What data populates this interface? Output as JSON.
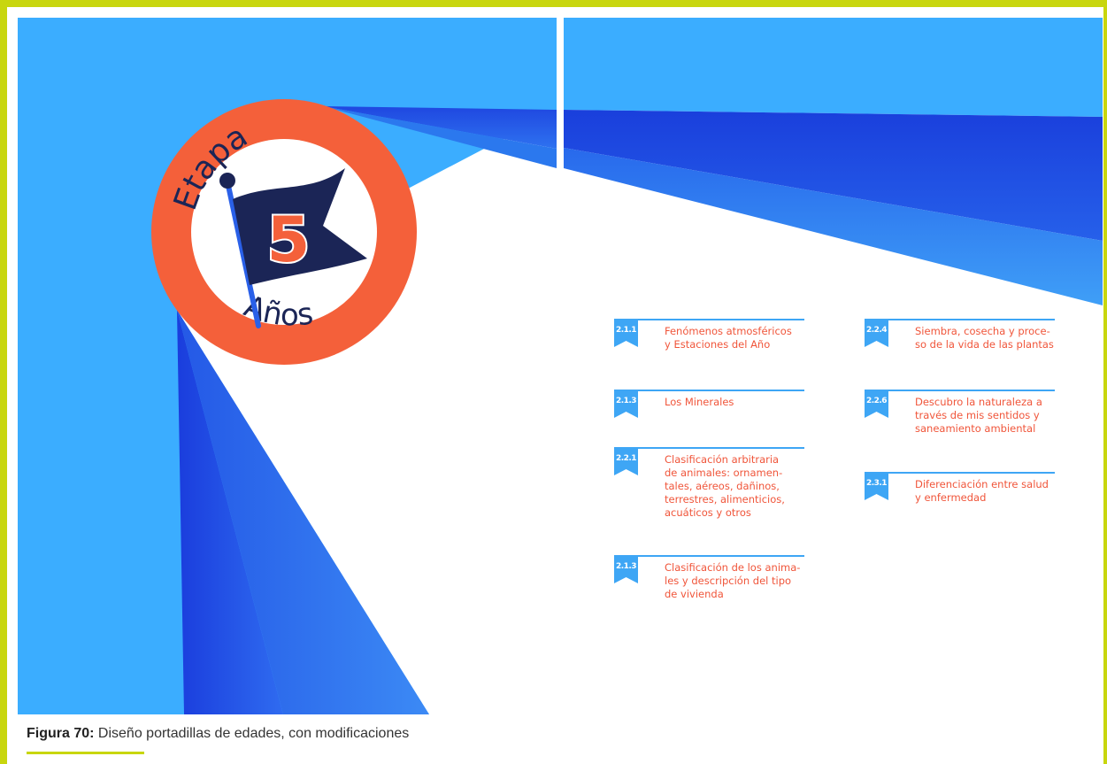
{
  "badge": {
    "top_word": "Etapa",
    "number": "5",
    "bottom_word": "Años"
  },
  "topics": [
    {
      "code": "2.1.1",
      "text": "Fenómenos atmosféricos\ny Estaciones del Año"
    },
    {
      "code": "2.1.3",
      "text": "Los Minerales"
    },
    {
      "code": "2.2.1",
      "text": "Clasificación arbitraria\nde animales: ornamen-\ntales, aéreos, dañinos,\nterrestres, alimenticios,\nacuáticos y otros"
    },
    {
      "code": "2.1.3",
      "text": "Clasificación de los anima-\nles y descripción del tipo\nde vivienda"
    },
    {
      "code": "2.2.4",
      "text": "Siembra, cosecha y proce-\nso de la vida de las plantas"
    },
    {
      "code": "2.2.6",
      "text": "Descubro la naturaleza  a\ntravés de mis sentidos y\nsaneamiento  ambiental"
    },
    {
      "code": "2.3.1",
      "text": "Diferenciación entre salud\ny enfermedad"
    }
  ],
  "caption": {
    "label": "Figura 70:",
    "text": " Diseño portadillas de edades, con modificaciones"
  },
  "colors": {
    "frame": "#c8d60e",
    "sky": "#3badff",
    "deep_blue": "#1f4fe0",
    "badge_ring": "#f4603a",
    "flag": "#1b2556",
    "topic_text": "#f0553a",
    "ribbon": "#3ea6f5"
  }
}
